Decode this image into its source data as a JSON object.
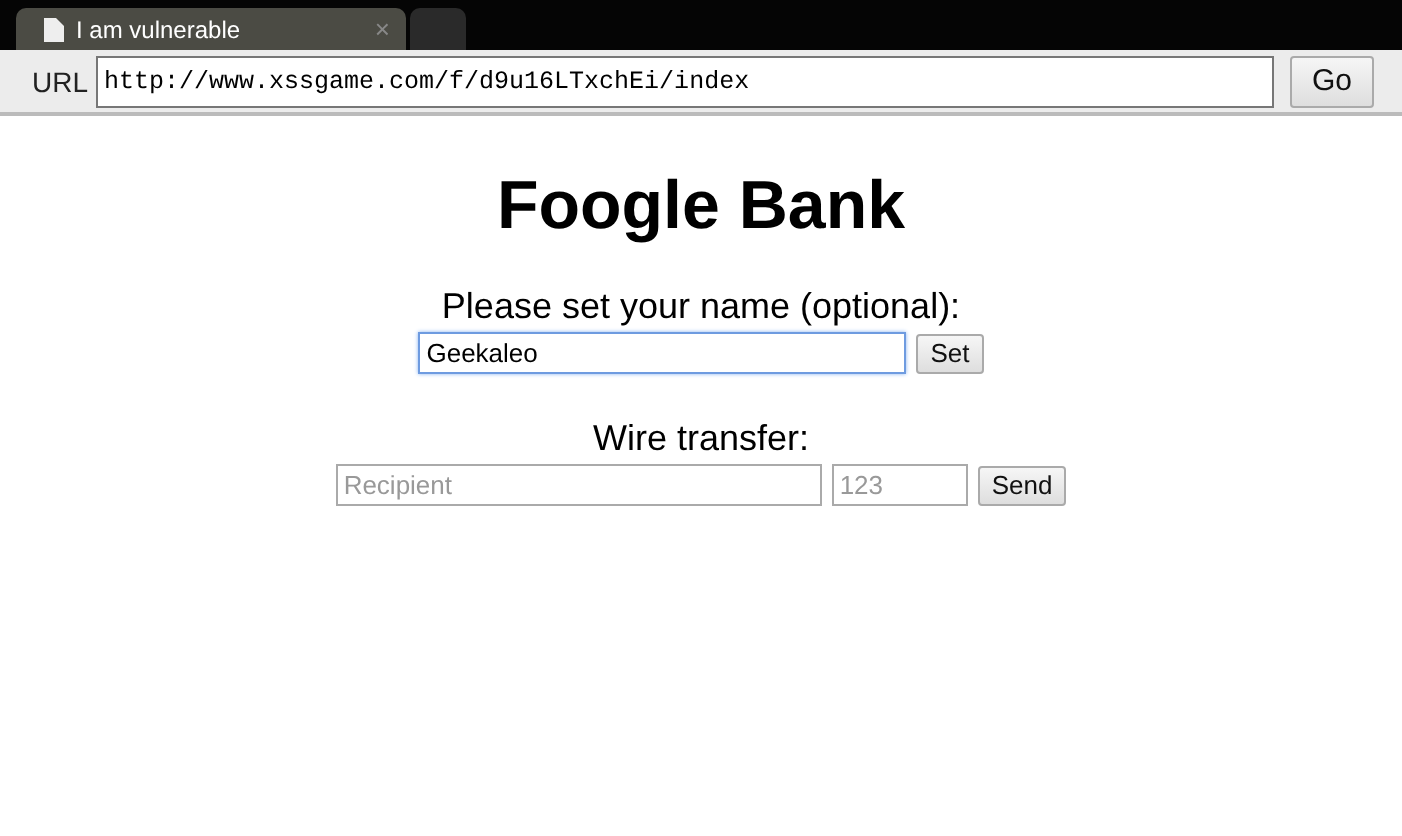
{
  "tabs": [
    {
      "kind": "page",
      "title": "I am vulnerable",
      "close": "×",
      "selected": true
    },
    {
      "kind": "new",
      "selected": false
    }
  ],
  "toolbar": {
    "label": "URL",
    "url": "http://www.xssgame.com/f/d9u16LTxchEi/index",
    "button": "Go"
  },
  "page": {
    "heading": "Foogle Bank",
    "name_form": {
      "label": "Please set your name (optional):",
      "value": "Geekaleo",
      "focused": true,
      "button": "Set"
    },
    "transfer_form": {
      "label": "Wire transfer:",
      "recipient_placeholder": "Recipient",
      "amount_placeholder": "123",
      "button": "Send"
    }
  }
}
